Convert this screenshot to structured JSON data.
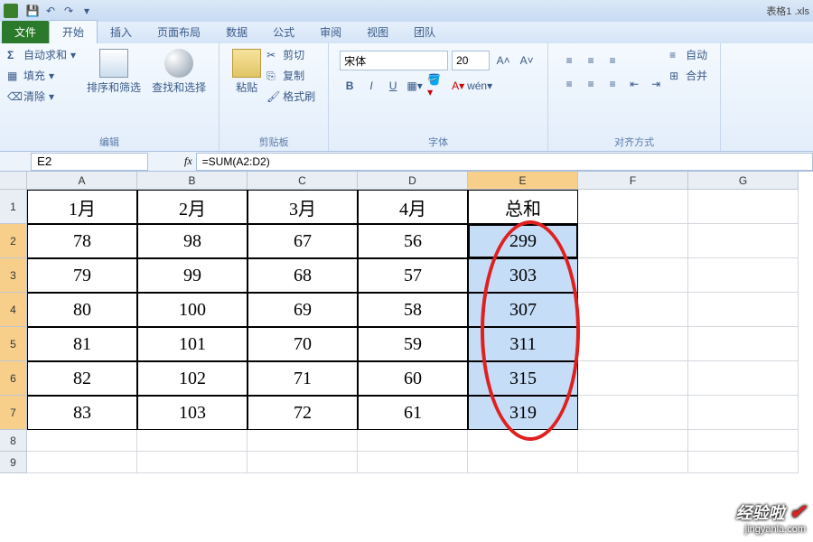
{
  "title": "表格1 .xls",
  "tabs": {
    "file": "文件",
    "home": "开始",
    "insert": "插入",
    "layout": "页面布局",
    "data": "数据",
    "formula": "公式",
    "review": "审阅",
    "view": "视图",
    "team": "团队"
  },
  "ribbon": {
    "edit": {
      "autosum": "自动求和",
      "fill": "填充",
      "clear": "清除",
      "sort": "排序和筛选",
      "find": "查找和选择",
      "label": "编辑"
    },
    "clip": {
      "paste": "粘贴",
      "cut": "剪切",
      "copy": "复制",
      "brush": "格式刷",
      "label": "剪贴板"
    },
    "font": {
      "name": "宋体",
      "size": "20",
      "label": "字体"
    },
    "align": {
      "auto": "自动",
      "merge": "合并",
      "label": "对齐方式"
    }
  },
  "fbar": {
    "name": "E2",
    "fx": "fx",
    "formula": "=SUM(A2:D2)"
  },
  "cols": [
    "A",
    "B",
    "C",
    "D",
    "E",
    "F",
    "G"
  ],
  "headers": [
    "1月",
    "2月",
    "3月",
    "4月",
    "总和"
  ],
  "rows": [
    [
      "78",
      "98",
      "67",
      "56",
      "299"
    ],
    [
      "79",
      "99",
      "68",
      "57",
      "303"
    ],
    [
      "80",
      "100",
      "69",
      "58",
      "307"
    ],
    [
      "81",
      "101",
      "70",
      "59",
      "311"
    ],
    [
      "82",
      "102",
      "71",
      "60",
      "315"
    ],
    [
      "83",
      "103",
      "72",
      "61",
      "319"
    ]
  ],
  "chart_data": {
    "type": "table",
    "columns": [
      "1月",
      "2月",
      "3月",
      "4月",
      "总和"
    ],
    "data": [
      [
        78,
        98,
        67,
        56,
        299
      ],
      [
        79,
        99,
        68,
        57,
        303
      ],
      [
        80,
        100,
        69,
        58,
        307
      ],
      [
        81,
        101,
        70,
        59,
        311
      ],
      [
        82,
        102,
        71,
        60,
        315
      ],
      [
        83,
        103,
        72,
        61,
        319
      ]
    ]
  },
  "watermark": {
    "main": "经验啦",
    "sub": "jingyanla.com"
  }
}
